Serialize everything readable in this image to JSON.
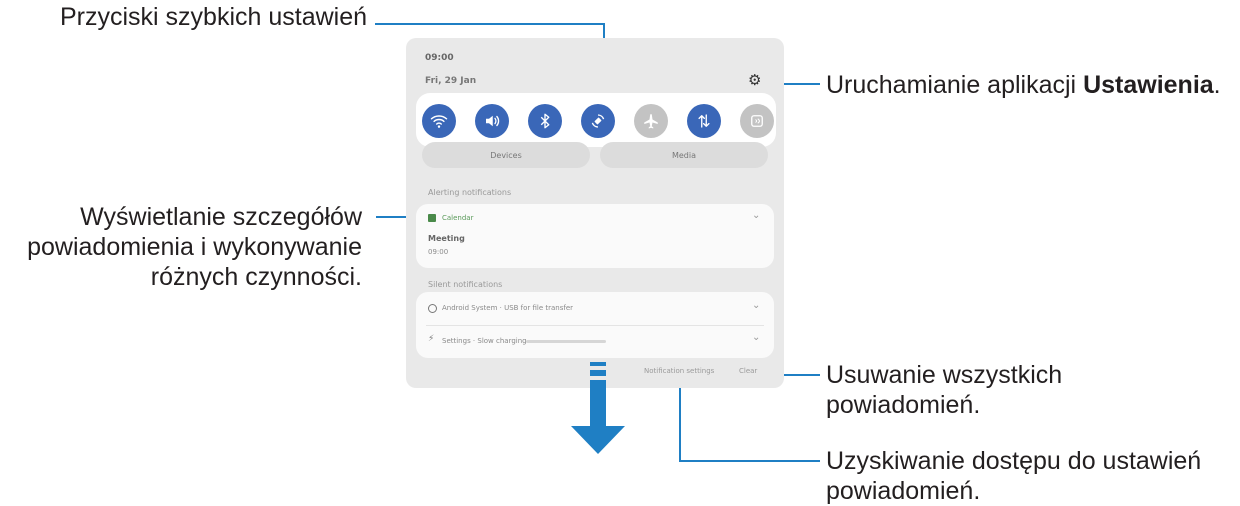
{
  "callouts": {
    "quick_buttons": "Przyciski szybkich ustawień",
    "settings_prefix": "Uruchamianie aplikacji ",
    "settings_bold": "Ustawienia",
    "settings_suffix": ".",
    "details_line1": "Wyświetlanie szczegółów",
    "details_line2": "powiadomienia i wykonywanie",
    "details_line3": "różnych czynności.",
    "clear_line1": "Usuwanie wszystkich",
    "clear_line2": "powiadomień.",
    "notif_settings_line1": "Uzyskiwanie dostępu do ustawień",
    "notif_settings_line2": "powiadomień."
  },
  "panel": {
    "time": "09:00",
    "date": "Fri, 29 Jan",
    "quick_settings": [
      {
        "icon": "wifi-icon",
        "state": "on"
      },
      {
        "icon": "sound-icon",
        "state": "on"
      },
      {
        "icon": "bluetooth-icon",
        "state": "on"
      },
      {
        "icon": "auto-rotate-icon",
        "state": "on"
      },
      {
        "icon": "airplane-mode-icon",
        "state": "off"
      },
      {
        "icon": "mobile-data-icon",
        "state": "on"
      },
      {
        "icon": "nfc-icon",
        "state": "off"
      }
    ],
    "devices_label": "Devices",
    "media_label": "Media",
    "alerting_title": "Alerting notifications",
    "calendar_app": "Calendar",
    "meeting_title": "Meeting",
    "meeting_time": "09:00",
    "silent_title": "Silent notifications",
    "android_system_text": "Android System · USB for file transfer",
    "settings_text": "Settings · Slow charging",
    "notification_settings_label": "Notification settings",
    "clear_label": "Clear"
  },
  "colors": {
    "accent": "#1f7fc4",
    "toggle_on": "#3a67b8",
    "toggle_off": "#c3c3c3"
  }
}
